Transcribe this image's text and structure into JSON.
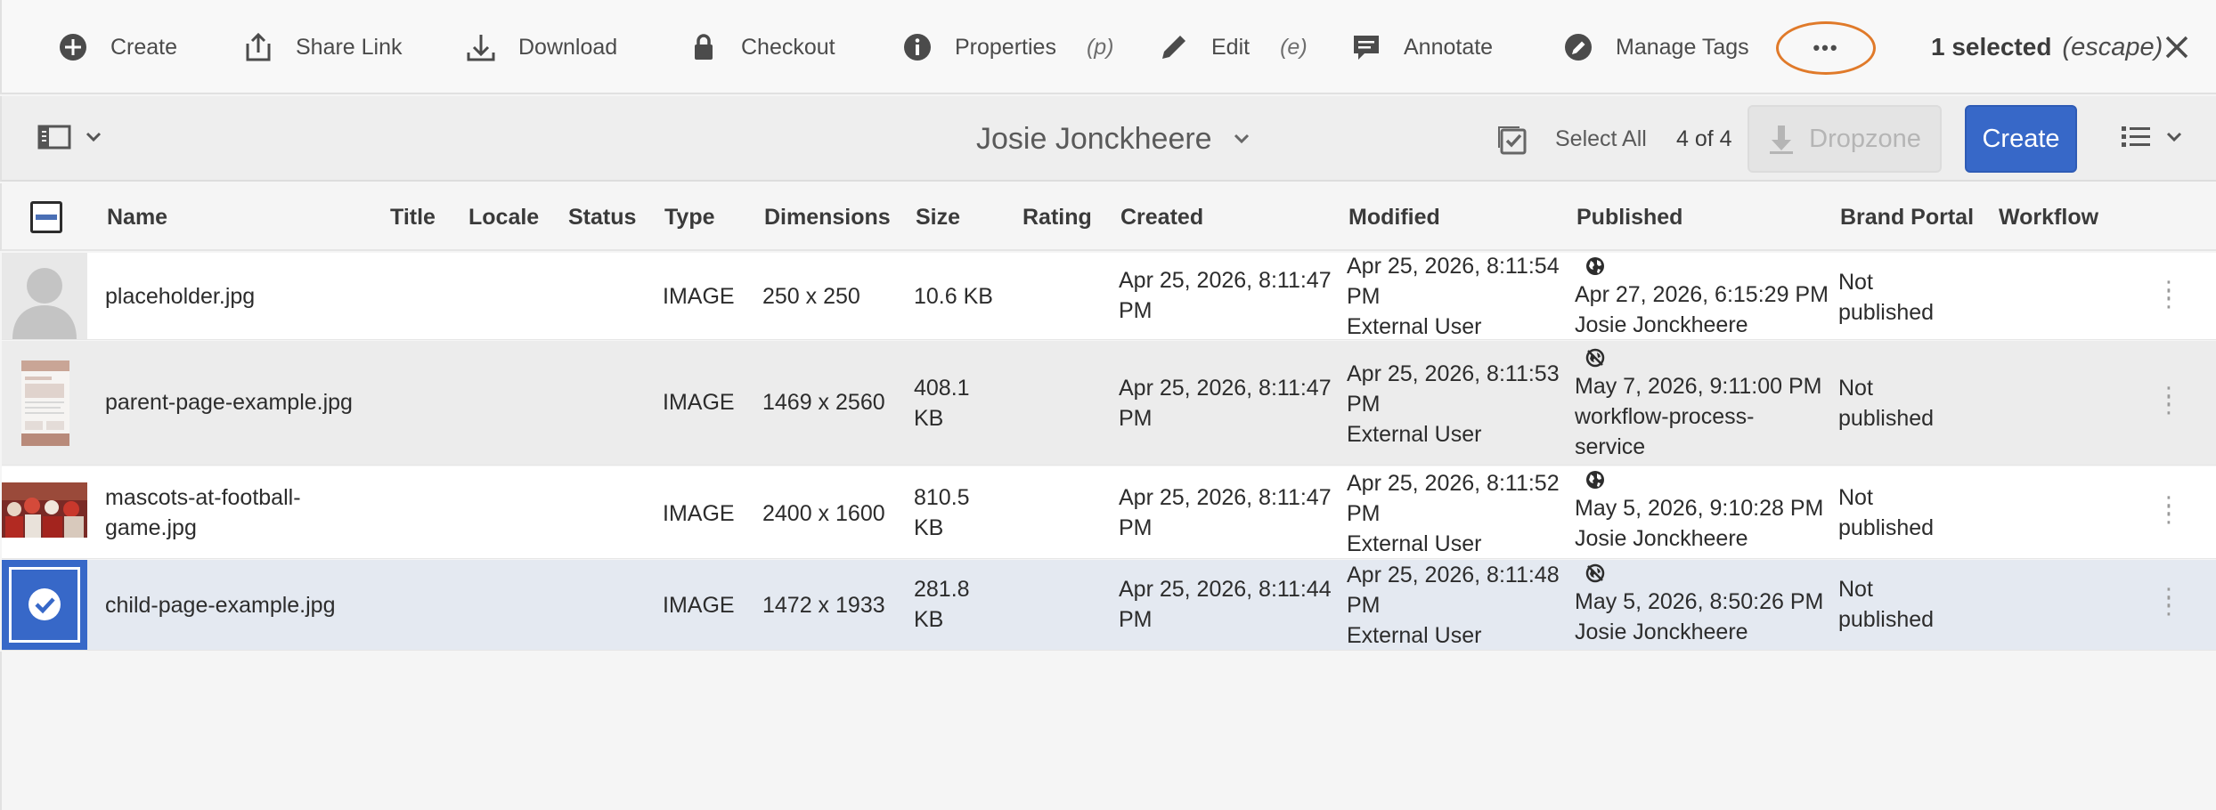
{
  "actionbar": {
    "items": [
      {
        "label": "Create",
        "icon": "plus-circle-icon"
      },
      {
        "label": "Share Link",
        "icon": "share-icon"
      },
      {
        "label": "Download",
        "icon": "download-icon"
      },
      {
        "label": "Checkout",
        "icon": "lock-icon"
      },
      {
        "label": "Properties",
        "shortcut": "(p)",
        "icon": "info-icon"
      },
      {
        "label": "Edit",
        "shortcut": "(e)",
        "icon": "pencil-icon"
      },
      {
        "label": "Annotate",
        "icon": "annotate-icon"
      },
      {
        "label": "Manage Tags",
        "icon": "tag-edit-icon"
      }
    ],
    "more_label": "•••",
    "selected_label": "1 selected",
    "escape_label": "(escape)",
    "highlight_color": "#e07a2a"
  },
  "toolbar": {
    "folder_title": "Josie Jonckheere",
    "select_all_label": "Select All",
    "count_label": "4 of 4",
    "dropzone_label": "Dropzone",
    "create_label": "Create",
    "accent_color": "#3768c8"
  },
  "table": {
    "columns": {
      "name": "Name",
      "title": "Title",
      "locale": "Locale",
      "status": "Status",
      "type": "Type",
      "dimensions": "Dimensions",
      "size": "Size",
      "rating": "Rating",
      "created": "Created",
      "modified": "Modified",
      "published": "Published",
      "brand_portal": "Brand Portal",
      "workflow": "Workflow"
    },
    "rows": [
      {
        "name_lines": [
          "placeholder.jpg"
        ],
        "type": "IMAGE",
        "dimensions": "250 x 250",
        "size_lines": [
          "10.6 KB"
        ],
        "created_lines": [
          "Apr 25, 2026, 8:11:47",
          "PM"
        ],
        "modified_lines": [
          "Apr 25, 2026, 8:11:54",
          "PM",
          "External User"
        ],
        "published_icon": "globe-icon",
        "published_lines": [
          "Apr 27, 2026, 6:15:29 PM",
          "Josie Jonckheere"
        ],
        "brand_lines": [
          "Not",
          "published"
        ],
        "selected": false
      },
      {
        "name_lines": [
          "parent-page-example.jpg"
        ],
        "type": "IMAGE",
        "dimensions": "1469 x 2560",
        "size_lines": [
          "408.1",
          "KB"
        ],
        "created_lines": [
          "Apr 25, 2026, 8:11:47",
          "PM"
        ],
        "modified_lines": [
          "Apr 25, 2026, 8:11:53",
          "PM",
          "External User"
        ],
        "published_icon": "globe-off-icon",
        "published_lines": [
          "May 7, 2026, 9:11:00 PM",
          "workflow-process-",
          "service"
        ],
        "brand_lines": [
          "Not",
          "published"
        ],
        "selected": false
      },
      {
        "name_lines": [
          "mascots-at-football-",
          "game.jpg"
        ],
        "type": "IMAGE",
        "dimensions": "2400 x 1600",
        "size_lines": [
          "810.5",
          "KB"
        ],
        "created_lines": [
          "Apr 25, 2026, 8:11:47",
          "PM"
        ],
        "modified_lines": [
          "Apr 25, 2026, 8:11:52",
          "PM",
          "External User"
        ],
        "published_icon": "globe-icon",
        "published_lines": [
          "May 5, 2026, 9:10:28 PM",
          "Josie Jonckheere"
        ],
        "brand_lines": [
          "Not",
          "published"
        ],
        "selected": false
      },
      {
        "name_lines": [
          "child-page-example.jpg"
        ],
        "type": "IMAGE",
        "dimensions": "1472 x 1933",
        "size_lines": [
          "281.8",
          "KB"
        ],
        "created_lines": [
          "Apr 25, 2026, 8:11:44",
          "PM"
        ],
        "modified_lines": [
          "Apr 25, 2026, 8:11:48",
          "PM",
          "External User"
        ],
        "published_icon": "globe-off-icon",
        "published_lines": [
          "May 5, 2026, 8:50:26 PM",
          "Josie Jonckheere"
        ],
        "brand_lines": [
          "Not",
          "published"
        ],
        "selected": true
      }
    ]
  }
}
